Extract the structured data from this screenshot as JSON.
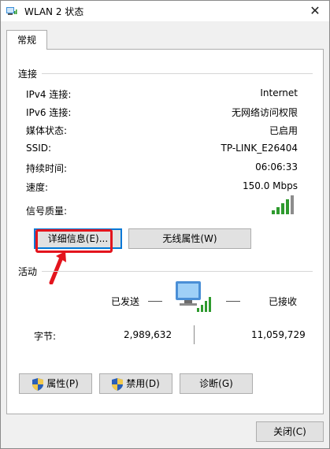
{
  "window": {
    "title": "WLAN 2 状态",
    "close_symbol": "✕"
  },
  "tab": {
    "label": "常规"
  },
  "connection": {
    "heading": "连接",
    "rows": [
      {
        "label": "IPv4 连接:",
        "value": "Internet"
      },
      {
        "label": "IPv6 连接:",
        "value": "无网络访问权限"
      },
      {
        "label": "媒体状态:",
        "value": "已启用"
      },
      {
        "label": "SSID:",
        "value": "TP-LINK_E26404"
      },
      {
        "label": "持续时间:",
        "value": "06:06:33"
      },
      {
        "label": "速度:",
        "value": "150.0 Mbps"
      },
      {
        "label": "信号质量:",
        "value": ""
      }
    ],
    "signal_bars_filled": 5,
    "signal_bars_total": 5
  },
  "buttons": {
    "details": "详细信息(E)...",
    "wireless": "无线属性(W)",
    "properties": "属性(P)",
    "disable": "禁用(D)",
    "diagnose": "诊断(G)",
    "close": "关闭(C)"
  },
  "activity": {
    "heading": "活动",
    "sent_label": "已发送",
    "received_label": "已接收",
    "bytes_label": "字节:",
    "bytes_sent": "2,989,632",
    "bytes_received": "11,059,729"
  },
  "colors": {
    "accent": "#0078d7",
    "highlight": "#e3141d",
    "signal": "#2e9a2e"
  },
  "icons": [
    "wifi-adapter-icon",
    "network-computer-icon",
    "shield-icon",
    "arrow-icon"
  ]
}
